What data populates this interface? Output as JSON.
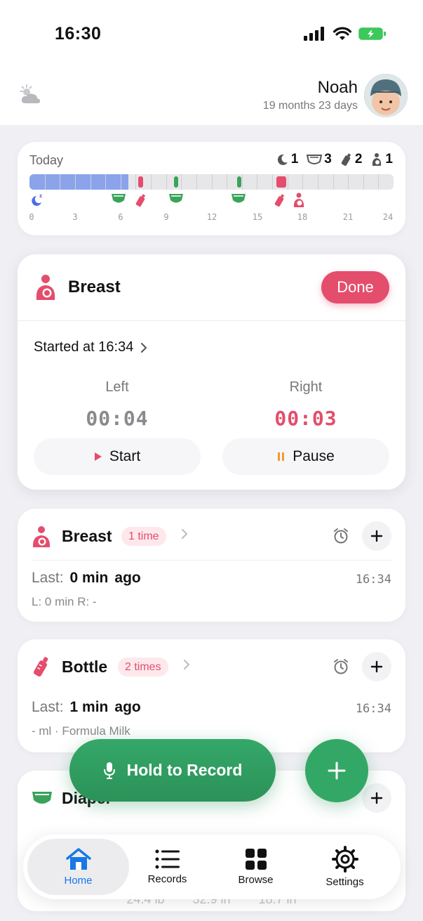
{
  "status": {
    "time": "16:30"
  },
  "header": {
    "name": "Noah",
    "age": "19 months 23 days"
  },
  "today": {
    "label": "Today",
    "counts": {
      "sleep": "1",
      "diaper": "3",
      "bottle": "2",
      "breast": "1"
    },
    "ticks": [
      "0",
      "3",
      "6",
      "9",
      "12",
      "15",
      "18",
      "21",
      "24"
    ]
  },
  "active": {
    "title": "Breast",
    "done_label": "Done",
    "started_at": "Started at 16:34",
    "left_label": "Left",
    "left_time": "00:04",
    "right_label": "Right",
    "right_time": "00:03",
    "start_label": "Start",
    "pause_label": "Pause"
  },
  "summary": {
    "breast": {
      "title": "Breast",
      "badge": "1 time",
      "last_key": "Last:",
      "last_value": "0 min",
      "last_suffix": "ago",
      "time": "16:34",
      "sub": "L: 0 min R: -"
    },
    "bottle": {
      "title": "Bottle",
      "badge": "2 times",
      "last_key": "Last:",
      "last_value": "1 min",
      "last_suffix": "ago",
      "time": "16:34",
      "sub": "- ml · Formula Milk"
    },
    "diaper": {
      "title": "Diaper"
    }
  },
  "record": {
    "label": "Hold to Record"
  },
  "peek": {
    "weight": "24.4 lb",
    "height": "32.9 in",
    "head": "18.7 in"
  },
  "tabs": [
    {
      "label": "Home"
    },
    {
      "label": "Records"
    },
    {
      "label": "Browse"
    },
    {
      "label": "Settings"
    }
  ],
  "colors": {
    "accent": "#e44d6c",
    "green": "#33a866",
    "blue": "#1778e6",
    "sleep": "#8aa3ea"
  }
}
